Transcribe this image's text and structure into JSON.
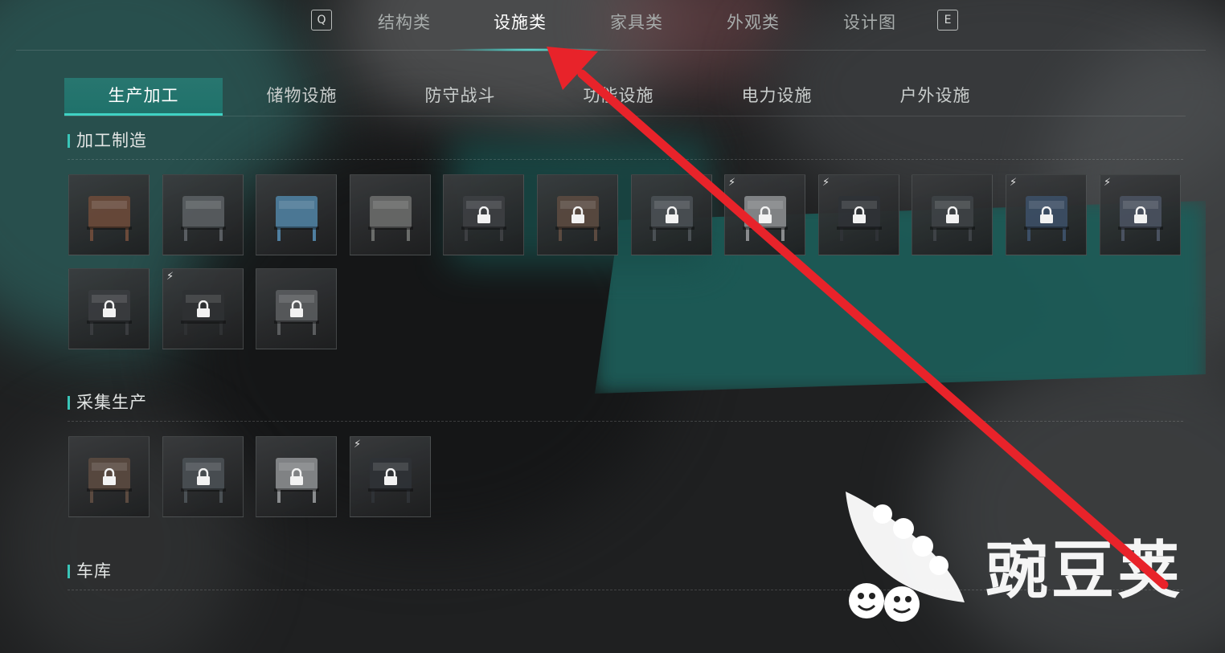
{
  "top_tabs": {
    "left_key": "Q",
    "right_key": "E",
    "items": [
      {
        "label": "结构类",
        "active": false
      },
      {
        "label": "设施类",
        "active": true
      },
      {
        "label": "家具类",
        "active": false
      },
      {
        "label": "外观类",
        "active": false
      },
      {
        "label": "设计图",
        "active": false
      }
    ]
  },
  "sub_tabs": [
    {
      "label": "生产加工",
      "active": true
    },
    {
      "label": "储物设施",
      "active": false
    },
    {
      "label": "防守战斗",
      "active": false
    },
    {
      "label": "功能设施",
      "active": false
    },
    {
      "label": "电力设施",
      "active": false
    },
    {
      "label": "户外设施",
      "active": false
    }
  ],
  "sections": [
    {
      "title": "加工制造",
      "items": [
        {
          "icon": "workbench-icon",
          "locked": false,
          "powered": false
        },
        {
          "icon": "tool-bench-icon",
          "locked": false,
          "powered": false
        },
        {
          "icon": "blue-table-icon",
          "locked": false,
          "powered": false
        },
        {
          "icon": "loom-icon",
          "locked": false,
          "powered": false
        },
        {
          "icon": "cabinet-icon",
          "locked": true,
          "powered": false
        },
        {
          "icon": "desk-icon",
          "locked": true,
          "powered": false
        },
        {
          "icon": "machine-bench-icon",
          "locked": true,
          "powered": false
        },
        {
          "icon": "refrigerator-icon",
          "locked": true,
          "powered": true
        },
        {
          "icon": "console-icon",
          "locked": true,
          "powered": true
        },
        {
          "icon": "drafting-table-icon",
          "locked": true,
          "powered": false
        },
        {
          "icon": "barrel-machine-icon",
          "locked": true,
          "powered": true
        },
        {
          "icon": "generator-icon",
          "locked": true,
          "powered": true
        },
        {
          "icon": "stove-icon",
          "locked": true,
          "powered": false
        },
        {
          "icon": "gas-tank-icon",
          "locked": true,
          "powered": true
        },
        {
          "icon": "rack-icon",
          "locked": true,
          "powered": false
        }
      ]
    },
    {
      "title": "采集生产",
      "items": [
        {
          "icon": "dirt-pile-icon",
          "locked": true,
          "powered": false
        },
        {
          "icon": "planter-box-icon",
          "locked": true,
          "powered": false
        },
        {
          "icon": "water-collector-icon",
          "locked": true,
          "powered": false
        },
        {
          "icon": "pump-machine-icon",
          "locked": true,
          "powered": true
        }
      ]
    },
    {
      "title": "车库",
      "items": []
    }
  ],
  "watermark": {
    "text": "豌豆荚",
    "icon": "pea-pod-logo-icon"
  },
  "annotation": {
    "icon": "red-arrow-icon",
    "color": "#e8232a"
  },
  "colors": {
    "accent": "#3fd2c4",
    "active_tab_bg": "#1f7a72"
  }
}
